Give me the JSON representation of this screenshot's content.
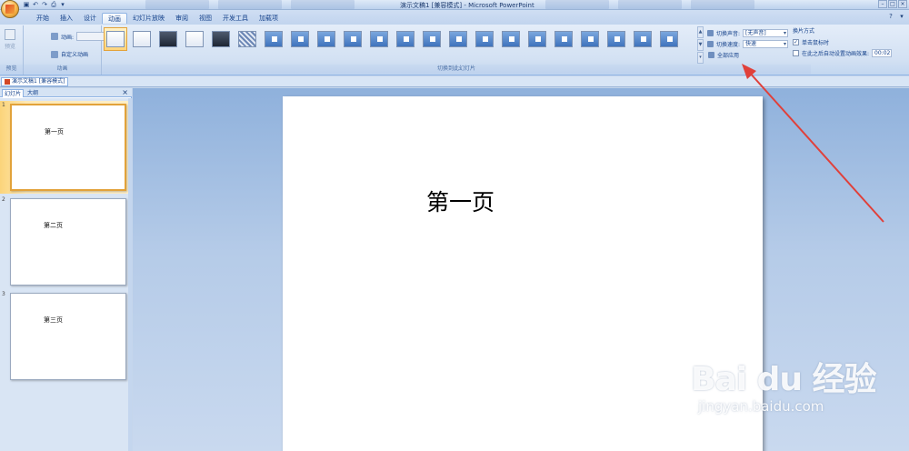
{
  "window": {
    "title": "演示文稿1 [兼容模式] - Microsoft PowerPoint",
    "quick_access": [
      "save-icon",
      "undo-icon",
      "redo-icon",
      "print-icon",
      "customize-icon"
    ],
    "controls": [
      "–",
      "□",
      "×"
    ]
  },
  "ribbon": {
    "tabs": [
      "开始",
      "插入",
      "设计",
      "动画",
      "幻灯片放映",
      "审阅",
      "视图",
      "开发工具",
      "加载项"
    ],
    "active_tab": "动画",
    "preview_group": {
      "button_label": "预览",
      "group_label": "预览"
    },
    "animation_group": {
      "animate_label": "动画:",
      "custom_animation_label": "自定义动画",
      "group_label": "动画"
    },
    "transition_group": {
      "group_label": "切换到此幻灯片",
      "sound_label": "切换声音:",
      "sound_value": "[无声音]",
      "speed_label": "切换速度:",
      "speed_value": "快速",
      "apply_all_label": "全部应用"
    },
    "advance_group": {
      "header": "换片方式",
      "on_click_label": "单击鼠标时",
      "on_click_checked": true,
      "auto_label": "在此之后自动设置动画效果:",
      "auto_checked": false,
      "auto_time": "00:02"
    },
    "gallery_count": 22,
    "gallery_selected_index": 0
  },
  "document_tab": {
    "label": "演示文稿1 [兼容模式]"
  },
  "slides_pane": {
    "tabs": [
      "幻灯片",
      "大纲"
    ],
    "active_tab": "幻灯片",
    "slides": [
      {
        "number": "1",
        "title": "第一页",
        "selected": true
      },
      {
        "number": "2",
        "title": "第二页",
        "selected": false
      },
      {
        "number": "3",
        "title": "第三页",
        "selected": false
      }
    ]
  },
  "current_slide": {
    "title": "第一页"
  },
  "watermark": {
    "logo": "Bai du 经验",
    "url": "jingyan.baidu.com"
  },
  "colors": {
    "ribbon_bg": "#d3e1f3",
    "accent_selected": "#e3a23a",
    "annotation_arrow": "#e0403a",
    "canvas_bg": "#b5cbe8"
  }
}
